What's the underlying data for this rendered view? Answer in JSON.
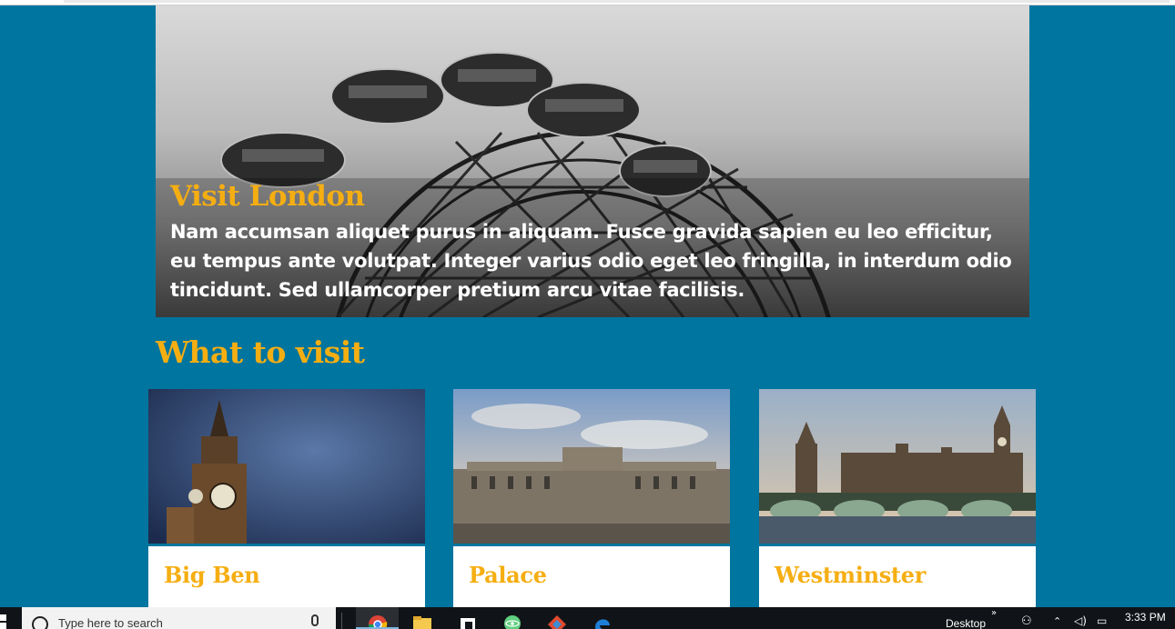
{
  "hero": {
    "title": "Visit London",
    "text": "Nam accumsan aliquet purus in aliquam. Fusce gravida sapien eu leo efficitur, eu tempus ante volutpat. Integer varius odio eget leo fringilla, in interdum odio tincidunt. Sed ullamcorper pretium arcu vitae facilisis."
  },
  "section": {
    "title": "What to visit"
  },
  "cards": [
    {
      "name": "Big Ben"
    },
    {
      "name": "Palace"
    },
    {
      "name": "Westminster"
    }
  ],
  "taskbar": {
    "search_placeholder": "Type here to search",
    "desktop_label": "Desktop",
    "time": "3:33 PM",
    "apps": [
      "chrome-icon",
      "file-explorer-icon",
      "app-icon",
      "atom-icon",
      "git-icon",
      "edge-icon"
    ]
  },
  "colors": {
    "background": "#00759f",
    "accent": "#f5ae12",
    "card": "#ffffff",
    "taskbar": "#101418"
  }
}
